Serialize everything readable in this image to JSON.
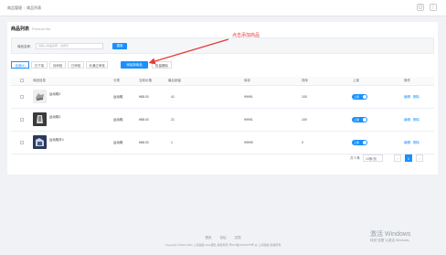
{
  "breadcrumb": [
    "商品管理",
    "商品列表"
  ],
  "panel": {
    "title": "商品列表",
    "subtitle": "Product list"
  },
  "search": {
    "label": "商品名称:",
    "placeholder": "请输入商品名称、关键字",
    "button": "搜索"
  },
  "tabs": [
    "全部(4)",
    "已下架",
    "待审核",
    "已审核",
    "未通过审核"
  ],
  "actions": {
    "add": "添加新商品",
    "batch_delete": "批量删除"
  },
  "annotation": "点击添加商品",
  "colors": {
    "accent": "#1890ff",
    "annotation": "#e53935"
  },
  "table": {
    "headers": [
      "商品信息",
      "分类",
      "当前价格",
      "最后销量",
      "库存",
      "排序",
      "上架",
      "操作"
    ],
    "rows": [
      {
        "name": "运动鞋1",
        "category": "运动鞋",
        "price": "¥88.00",
        "sales": "41",
        "stock": "99991",
        "sort": "100",
        "status": "上架",
        "edit": "编辑",
        "delete": "删除"
      },
      {
        "name": "运动鞋2",
        "category": "运动鞋",
        "price": "¥88.00",
        "sales": "21",
        "stock": "99991",
        "sort": "100",
        "status": "上架",
        "edit": "编辑",
        "delete": "删除"
      },
      {
        "name": "运动鞋外1",
        "category": "运动鞋",
        "price": "¥88.00",
        "sales": "1",
        "stock": "99999",
        "sort": "0",
        "status": "上架",
        "edit": "编辑",
        "delete": "删除"
      }
    ]
  },
  "pagination": {
    "total": "共 3 条",
    "page_size": "10条/页",
    "current": "1",
    "prev": "‹",
    "next": "›"
  },
  "footer": {
    "links": [
      "首页",
      "论坛",
      "文档"
    ],
    "copyright": "Copyright ©2014-2021 上海锐捷 shop团队 版权所有 粤ICP备10078376号 @ 上海锐捷 版权所有"
  },
  "watermark": {
    "title": "激活 Windows",
    "subtitle": "转到\"设置\"以激活 Windows。"
  }
}
